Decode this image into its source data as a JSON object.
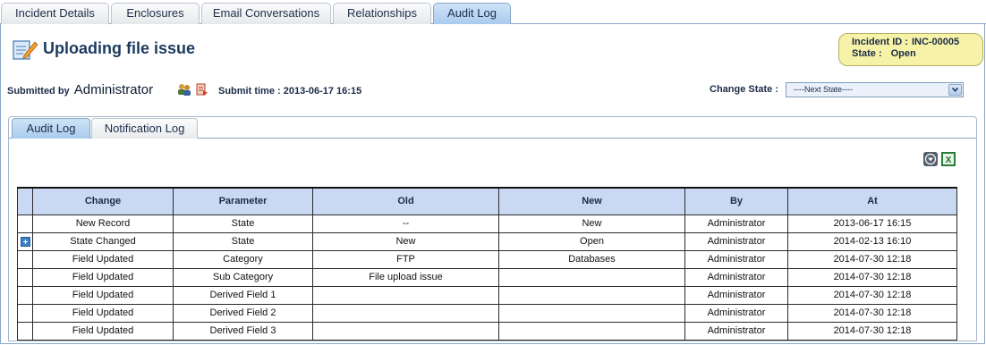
{
  "top_tabs": [
    "Incident Details",
    "Enclosures",
    "Email Conversations",
    "Relationships",
    "Audit Log"
  ],
  "page": {
    "title": "Uploading file issue",
    "submitted_by_label": "Submitted by",
    "submitted_by": "Administrator",
    "submit_time_label": "Submit time :",
    "submit_time": "2013-06-17 16:15",
    "change_state_label": "Change State :",
    "change_state_value": "----Next State----"
  },
  "incident": {
    "id_label": "Incident ID :",
    "id": "INC-00005",
    "state_label": "State :",
    "state": "Open"
  },
  "sub_tabs": [
    "Audit Log",
    "Notification Log"
  ],
  "table": {
    "headers": [
      "Change",
      "Parameter",
      "Old",
      "New",
      "By",
      "At"
    ],
    "rows": [
      [
        "New Record",
        "State",
        "--",
        "New",
        "Administrator",
        "2013-06-17 16:15"
      ],
      [
        "State Changed",
        "State",
        "New",
        "Open",
        "Administrator",
        "2014-02-13 16:10"
      ],
      [
        "Field Updated",
        "Category",
        "FTP",
        "Databases",
        "Administrator",
        "2014-07-30 12:18"
      ],
      [
        "Field Updated",
        "Sub Category",
        "File upload issue",
        "",
        "Administrator",
        "2014-07-30 12:18"
      ],
      [
        "Field Updated",
        "Derived Field 1",
        "",
        "",
        "Administrator",
        "2014-07-30 12:18"
      ],
      [
        "Field Updated",
        "Derived Field 2",
        "",
        "",
        "Administrator",
        "2014-07-30 12:18"
      ],
      [
        "Field Updated",
        "Derived Field 3",
        "",
        "",
        "Administrator",
        "2014-07-30 12:18"
      ]
    ]
  }
}
